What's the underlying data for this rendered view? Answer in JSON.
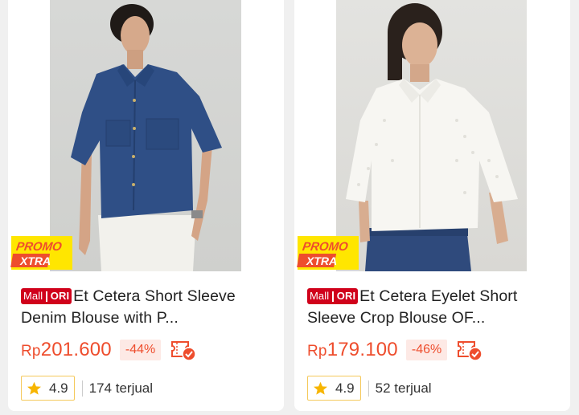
{
  "products": [
    {
      "badge": {
        "mall": "Mall",
        "ori": "ORI"
      },
      "promo": {
        "line1": "PROMO",
        "line2": "XTRA"
      },
      "title": "Et Cetera Short Sleeve Denim Blouse with P...",
      "price": {
        "currency": "Rp",
        "amount": "201.600"
      },
      "discount": "-44%",
      "voucher_icon": "voucher-check-icon",
      "rating": "4.9",
      "sold": "174 terjual"
    },
    {
      "badge": {
        "mall": "Mall",
        "ori": "ORI"
      },
      "promo": {
        "line1": "PROMO",
        "line2": "XTRA"
      },
      "title": "Et Cetera Eyelet Short Sleeve Crop Blouse OF...",
      "price": {
        "currency": "Rp",
        "amount": "179.100"
      },
      "discount": "-46%",
      "voucher_icon": "voucher-check-icon",
      "rating": "4.9",
      "sold": "52 terjual"
    }
  ],
  "colors": {
    "accent": "#ee4d2d",
    "mall_badge": "#d0011b",
    "promo_yellow": "#ffe600",
    "rating_border": "#f5c95b",
    "star": "#f7b500"
  }
}
